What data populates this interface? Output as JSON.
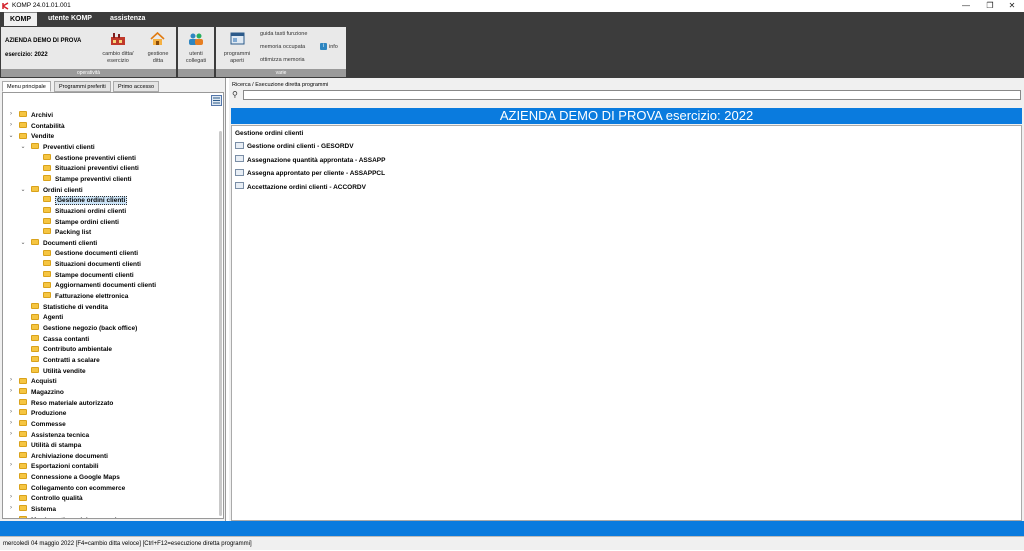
{
  "window": {
    "title": "KOMP 24.01.01.001",
    "minimize": "—",
    "maximize": "❐",
    "close": "✕"
  },
  "menu": {
    "tabs": [
      "KOMP",
      "utente KOMP",
      "assistenza"
    ]
  },
  "ribbon": {
    "company": "AZIENDA DEMO DI PROVA",
    "year": "esercizio: 2022",
    "group_operativita": "operatività",
    "btn_cambio": "cambio ditta/\nesercizio",
    "btn_gestione_ditta": "gestione\nditta",
    "btn_utenti": "utenti\ncollegati",
    "btn_programmi": "programmi\naperti",
    "guida": "guida tasti funzione",
    "memoria": "memoria occupata",
    "info": "info",
    "ottimizza": "ottimizza memoria",
    "group_varie": "varie"
  },
  "left": {
    "tabs": [
      "Menu principale",
      "Programmi preferiti",
      "Primo accesso"
    ],
    "tree": [
      {
        "label": "Archivi",
        "level": 0,
        "arrow": ">"
      },
      {
        "label": "Contabilità",
        "level": 0,
        "arrow": ">"
      },
      {
        "label": "Vendite",
        "level": 0,
        "arrow": "v"
      },
      {
        "label": "Preventivi clienti",
        "level": 1,
        "arrow": "v"
      },
      {
        "label": "Gestione preventivi clienti",
        "level": 2,
        "arrow": ""
      },
      {
        "label": "Situazioni preventivi clienti",
        "level": 2,
        "arrow": ""
      },
      {
        "label": "Stampe preventivi clienti",
        "level": 2,
        "arrow": ""
      },
      {
        "label": "Ordini clienti",
        "level": 1,
        "arrow": "v"
      },
      {
        "label": "Gestione ordini clienti",
        "level": 2,
        "arrow": "",
        "selected": true
      },
      {
        "label": "Situazioni ordini clienti",
        "level": 2,
        "arrow": ""
      },
      {
        "label": "Stampe ordini clienti",
        "level": 2,
        "arrow": ""
      },
      {
        "label": "Packing list",
        "level": 2,
        "arrow": ""
      },
      {
        "label": "Documenti clienti",
        "level": 1,
        "arrow": "v"
      },
      {
        "label": "Gestione documenti clienti",
        "level": 2,
        "arrow": ""
      },
      {
        "label": "Situazioni documenti clienti",
        "level": 2,
        "arrow": ""
      },
      {
        "label": "Stampe documenti clienti",
        "level": 2,
        "arrow": ""
      },
      {
        "label": "Aggiornamenti documenti clienti",
        "level": 2,
        "arrow": ""
      },
      {
        "label": "Fatturazione elettronica",
        "level": 2,
        "arrow": ""
      },
      {
        "label": "Statistiche di vendita",
        "level": 1,
        "arrow": ""
      },
      {
        "label": "Agenti",
        "level": 1,
        "arrow": ""
      },
      {
        "label": "Gestione negozio (back office)",
        "level": 1,
        "arrow": ""
      },
      {
        "label": "Cassa contanti",
        "level": 1,
        "arrow": ""
      },
      {
        "label": "Contributo ambientale",
        "level": 1,
        "arrow": ""
      },
      {
        "label": "Contratti a scalare",
        "level": 1,
        "arrow": ""
      },
      {
        "label": "Utilità vendite",
        "level": 1,
        "arrow": ""
      },
      {
        "label": "Acquisti",
        "level": 0,
        "arrow": ">"
      },
      {
        "label": "Magazzino",
        "level": 0,
        "arrow": ">"
      },
      {
        "label": "Reso materiale autorizzato",
        "level": 0,
        "arrow": ""
      },
      {
        "label": "Produzione",
        "level": 0,
        "arrow": ">"
      },
      {
        "label": "Commesse",
        "level": 0,
        "arrow": ">"
      },
      {
        "label": "Assistenza tecnica",
        "level": 0,
        "arrow": ">"
      },
      {
        "label": "Utilità di stampa",
        "level": 0,
        "arrow": ""
      },
      {
        "label": "Archiviazione documenti",
        "level": 0,
        "arrow": ""
      },
      {
        "label": "Esportazioni contabili",
        "level": 0,
        "arrow": ">"
      },
      {
        "label": "Connessione a Google Maps",
        "level": 0,
        "arrow": ""
      },
      {
        "label": "Collegamento con ecommerce",
        "level": 0,
        "arrow": ""
      },
      {
        "label": "Controllo qualità",
        "level": 0,
        "arrow": ">"
      },
      {
        "label": "Sistema",
        "level": 0,
        "arrow": ">"
      },
      {
        "label": "Menù gestione del personale",
        "level": 0,
        "arrow": ""
      }
    ]
  },
  "right": {
    "search_label": "Ricerca / Esecuzione diretta programmi",
    "search_value": "",
    "banner": "AZIENDA DEMO DI PROVA  esercizio: 2022",
    "section": "Gestione ordini clienti",
    "programs": [
      "Gestione ordini clienti - GESORDV",
      "Assegnazione quantità approntata - ASSAPP",
      "Assegna approntato per cliente - ASSAPPCL",
      "Accettazione ordini clienti - ACCORDV"
    ]
  },
  "status": {
    "text": "mercoledì 04 maggio 2022   [F4=cambio ditta veloce] [Ctrl+F12=esecuzione diretta programmi]"
  },
  "colors": {
    "accent": "#0a7bde",
    "dark": "#3c3c3c",
    "folder": "#f5c542"
  }
}
